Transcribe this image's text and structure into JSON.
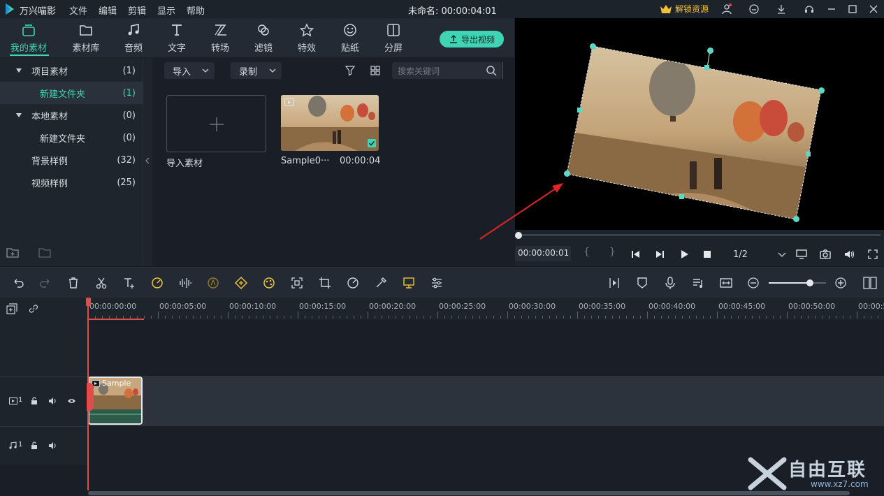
{
  "app": {
    "name": "万兴喵影",
    "document_title": "未命名: 00:00:04:01",
    "unlock_label": "解锁资源",
    "menu": [
      "文件",
      "编辑",
      "剪辑",
      "显示",
      "帮助"
    ]
  },
  "toolbar": {
    "tools": [
      {
        "label": "我的素材",
        "icon": "folder-stack-icon",
        "active": true
      },
      {
        "label": "素材库",
        "icon": "folder-icon",
        "active": false
      },
      {
        "label": "音频",
        "icon": "music-note-icon",
        "active": false
      },
      {
        "label": "文字",
        "icon": "text-t-icon",
        "active": false
      },
      {
        "label": "转场",
        "icon": "transition-icon",
        "active": false
      },
      {
        "label": "滤镜",
        "icon": "filter-circles-icon",
        "active": false
      },
      {
        "label": "特效",
        "icon": "star-effect-icon",
        "active": false
      },
      {
        "label": "贴纸",
        "icon": "sticker-face-icon",
        "active": false
      },
      {
        "label": "分屏",
        "icon": "split-screen-icon",
        "active": false
      }
    ],
    "export_label": "导出视频"
  },
  "left_panel": {
    "items": [
      {
        "name": "项目素材",
        "count": "(1)",
        "level": 0,
        "expanded": true,
        "selected": false
      },
      {
        "name": "新建文件夹",
        "count": "(1)",
        "level": 1,
        "selected": true
      },
      {
        "name": "本地素材",
        "count": "(0)",
        "level": 0,
        "expanded": true,
        "selected": false
      },
      {
        "name": "新建文件夹",
        "count": "(0)",
        "level": 1,
        "selected": false
      },
      {
        "name": "背景样例",
        "count": "(32)",
        "level": 0,
        "selected": false
      },
      {
        "name": "视频样例",
        "count": "(25)",
        "level": 0,
        "selected": false
      }
    ]
  },
  "media": {
    "import_dropdown": "导入",
    "record_dropdown": "录制",
    "search_placeholder": "搜索关键词",
    "import_card_label": "导入素材",
    "clip_name": "Sample0···",
    "clip_duration": "00:00:04"
  },
  "preview": {
    "timecode": "00:00:00:01",
    "quality": "1/2",
    "progress": 0.0
  },
  "timeline": {
    "ruler_labels": [
      "00:00:00:00",
      "00:00:05:00",
      "00:00:10:00",
      "00:00:15:00",
      "00:00:20:00",
      "00:00:25:00",
      "00:00:30:00",
      "00:00:35:00",
      "00:00:40:00",
      "00:00:45:00",
      "00:00:50:00",
      "00:00:5"
    ],
    "video_track_label": "1",
    "audio_track_label": "1",
    "clip_label": "Sample",
    "zoom_level": 0.72
  },
  "watermark": {
    "text": "自由互联",
    "url": "www.xz7.com"
  },
  "colors": {
    "accent": "#3fd4b3",
    "playhead": "#e34b4b",
    "gold": "#f0c23a"
  }
}
